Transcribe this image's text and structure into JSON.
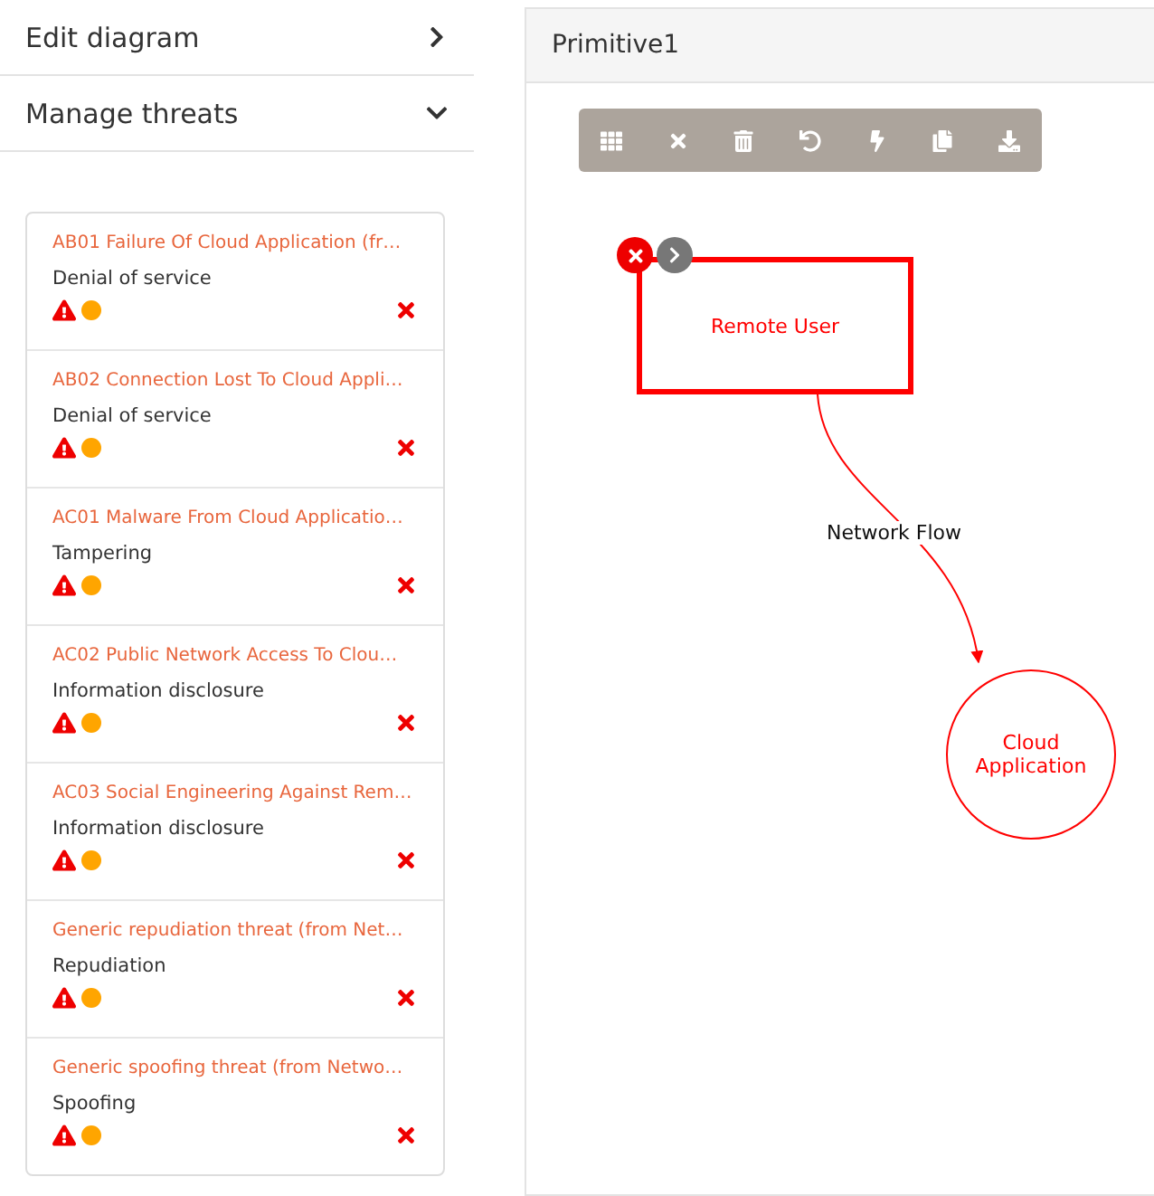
{
  "sidebar": {
    "sections": [
      {
        "label": "Edit diagram",
        "expanded": false
      },
      {
        "label": "Manage threats",
        "expanded": true
      }
    ]
  },
  "threats": [
    {
      "title": "AB01 Failure Of Cloud Application (fr…",
      "type": "Denial of service",
      "open": true,
      "color": "#ffa500"
    },
    {
      "title": "AB02 Connection Lost To Cloud Appli…",
      "type": "Denial of service",
      "open": true,
      "color": "#ffa500"
    },
    {
      "title": "AC01 Malware From Cloud Applicatio…",
      "type": "Tampering",
      "open": true,
      "color": "#ffa500"
    },
    {
      "title": "AC02 Public Network Access To Clou…",
      "type": "Information disclosure",
      "open": true,
      "color": "#ffa500"
    },
    {
      "title": "AC03 Social Engineering Against Rem…",
      "type": "Information disclosure",
      "open": true,
      "color": "#ffa500"
    },
    {
      "title": "Generic repudiation threat (from Net…",
      "type": "Repudiation",
      "open": true,
      "color": "#ffa500"
    },
    {
      "title": "Generic spoofing threat (from Netwo…",
      "type": "Spoofing",
      "open": true,
      "color": "#ffa500"
    }
  ],
  "diagram": {
    "title": "Primitive1",
    "toolbar": [
      {
        "kind": "grid"
      },
      {
        "kind": "close"
      },
      {
        "kind": "trash"
      },
      {
        "kind": "undo"
      },
      {
        "kind": "bolt"
      },
      {
        "kind": "copy"
      },
      {
        "kind": "download"
      }
    ],
    "nodes": [
      {
        "kind": "actor",
        "label": "Remote User",
        "selected": true
      },
      {
        "kind": "process",
        "label": "Cloud Application",
        "selected": false
      }
    ],
    "flows": [
      {
        "label": "Network Flow"
      }
    ]
  }
}
